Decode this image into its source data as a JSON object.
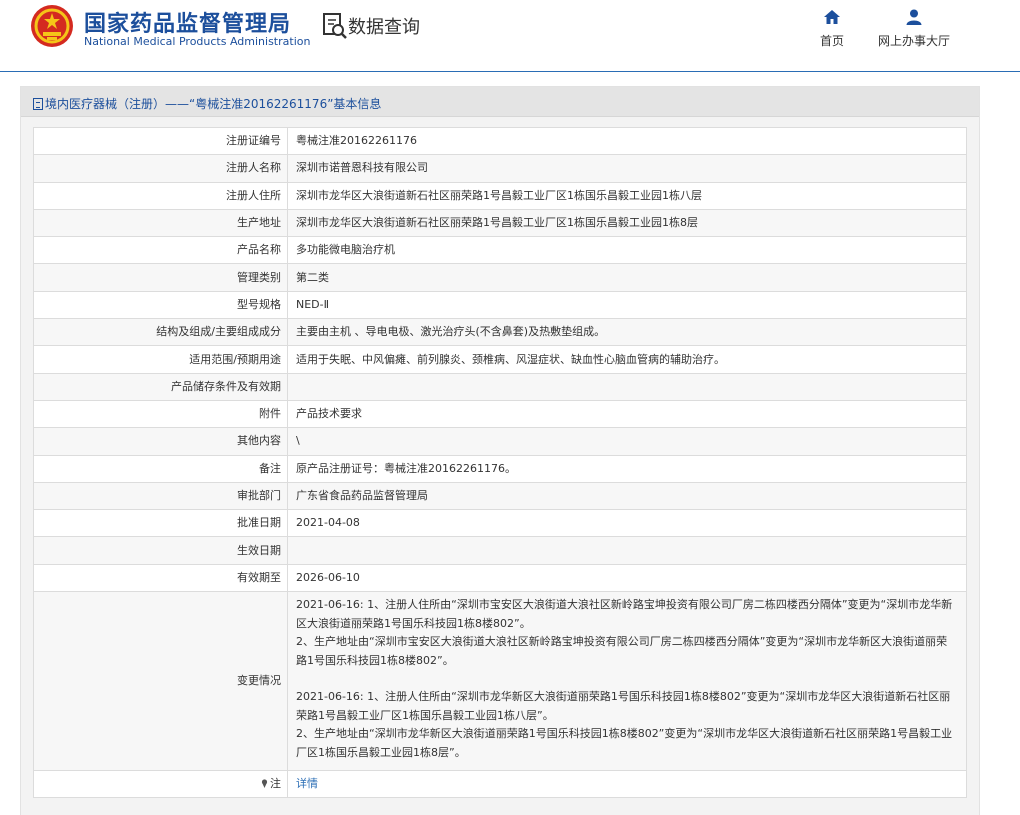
{
  "header": {
    "org_name_cn": "国家药品监督管理局",
    "org_name_en": "National Medical Products Administration",
    "query_title": "数据查询",
    "nav": [
      {
        "label": "首页",
        "icon": "home-icon"
      },
      {
        "label": "网上办事大厅",
        "icon": "user-icon"
      }
    ]
  },
  "panel": {
    "title": "境内医疗器械（注册）——“粤械注准20162261176”基本信息"
  },
  "rows": [
    {
      "label": "注册证编号",
      "value": "粤械注准20162261176"
    },
    {
      "label": "注册人名称",
      "value": "深圳市诺普恩科技有限公司"
    },
    {
      "label": "注册人住所",
      "value": "深圳市龙华区大浪街道新石社区丽荣路1号昌毅工业厂区1栋国乐昌毅工业园1栋八层"
    },
    {
      "label": "生产地址",
      "value": "深圳市龙华区大浪街道新石社区丽荣路1号昌毅工业厂区1栋国乐昌毅工业园1栋8层"
    },
    {
      "label": "产品名称",
      "value": "多功能微电脑治疗机"
    },
    {
      "label": "管理类别",
      "value": "第二类"
    },
    {
      "label": "型号规格",
      "value": "NED-Ⅱ"
    },
    {
      "label": "结构及组成/主要组成成分",
      "value": "主要由主机 、导电电极、激光治疗头(不含鼻套)及热敷垫组成。"
    },
    {
      "label": "适用范围/预期用途",
      "value": "适用于失眠、中风偏瘫、前列腺炎、颈椎病、风湿症状、缺血性心脑血管病的辅助治疗。"
    },
    {
      "label": "产品储存条件及有效期",
      "value": ""
    },
    {
      "label": "附件",
      "value": "产品技术要求"
    },
    {
      "label": "其他内容",
      "value": "\\"
    },
    {
      "label": "备注",
      "value": "原产品注册证号：粤械注准20162261176。"
    },
    {
      "label": "审批部门",
      "value": "广东省食品药品监督管理局"
    },
    {
      "label": "批准日期",
      "value": "2021-04-08"
    },
    {
      "label": "生效日期",
      "value": ""
    },
    {
      "label": "有效期至",
      "value": "2026-06-10"
    }
  ],
  "change": {
    "label": "变更情况",
    "paragraphs": [
      "2021-06-16: 1、注册人住所由“深圳市宝安区大浪街道大浪社区新岭路宝坤投资有限公司厂房二栋四楼西分隔体”变更为“深圳市龙华新区大浪街道丽荣路1号国乐科技园1栋8楼802”。",
      "2、生产地址由“深圳市宝安区大浪街道大浪社区新岭路宝坤投资有限公司厂房二栋四楼西分隔体”变更为“深圳市龙华新区大浪街道丽荣路1号国乐科技园1栋8楼802”。",
      "2021-06-16: 1、注册人住所由“深圳市龙华新区大浪街道丽荣路1号国乐科技园1栋8楼802”变更为“深圳市龙华区大浪街道新石社区丽荣路1号昌毅工业厂区1栋国乐昌毅工业园1栋八层”。",
      "2、生产地址由“深圳市龙华新区大浪街道丽荣路1号国乐科技园1栋8楼802”变更为“深圳市龙华区大浪街道新石社区丽荣路1号昌毅工业厂区1栋国乐昌毅工业园1栋8层”。"
    ]
  },
  "note": {
    "label": "注",
    "link": "详情"
  }
}
